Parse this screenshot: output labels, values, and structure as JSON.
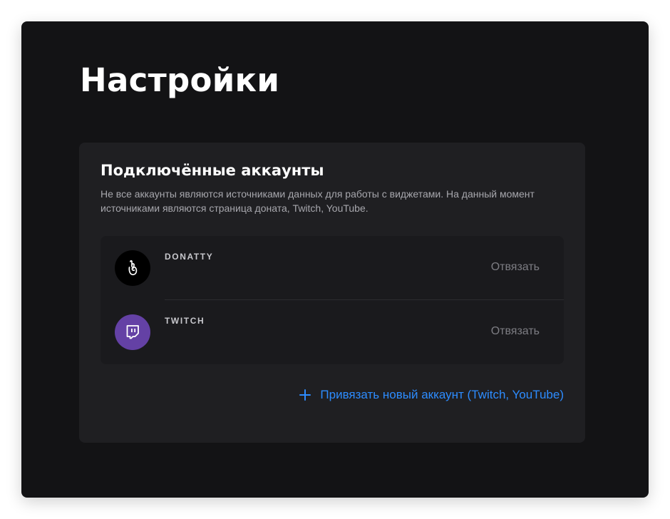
{
  "page": {
    "title": "Настройки"
  },
  "connected_accounts": {
    "title": "Подключённые аккаунты",
    "description": "Не все аккаунты являются источниками данных для работы с виджетами. На данный момент источниками являются страница доната, Twitch, YouTube.",
    "accounts": [
      {
        "name": "DONATTY",
        "icon": "donatty-logo-icon",
        "action_label": "Отвязать",
        "avatar_color": "#000000"
      },
      {
        "name": "TWITCH",
        "icon": "twitch-logo-icon",
        "action_label": "Отвязать",
        "avatar_color": "#6441a5"
      }
    ],
    "add_account_label": "Привязать новый аккаунт (Twitch, YouTube)",
    "add_icon": "plus-icon"
  },
  "colors": {
    "background": "#131315",
    "card": "#1f1f22",
    "accent": "#2d8cff",
    "muted_text": "#7d7d83"
  }
}
